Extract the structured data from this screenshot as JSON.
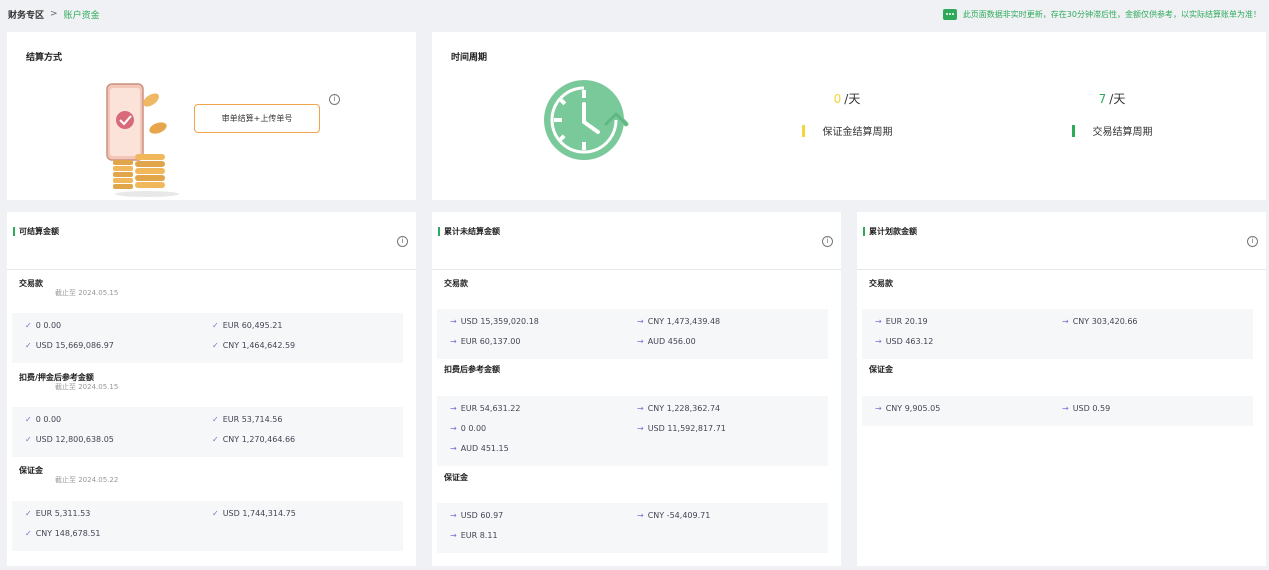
{
  "breadcrumb": {
    "level1": "财务专区",
    "separator": ">",
    "level2": "账户资金"
  },
  "notice": {
    "text": "此页面数据非实时更新，存在30分钟滞后性，金额仅供参考，以实际结算账单为准！"
  },
  "colors": {
    "accent": "#2eaa5a",
    "orange": "#f0a54a",
    "yellow": "#f5d53a",
    "clock": "#7ac99a",
    "item_icon": "#7a6fd0"
  },
  "settlement": {
    "title": "结算方式",
    "button": "审单结算+上传单号",
    "info": "i"
  },
  "period": {
    "title": "时间周期",
    "deposit": {
      "value": "0",
      "unit": "/天",
      "label": "保证金结算周期"
    },
    "trade": {
      "value": "7",
      "unit": "/天",
      "label": "交易结算周期"
    }
  },
  "available": {
    "title": "可结算金额",
    "info": "i",
    "sections": [
      {
        "title": "交易款",
        "date": "截止至 2024.05.15",
        "icon": "check-icon",
        "items": [
          "0 0.00",
          "EUR 60,495.21",
          "USD 15,669,086.97",
          "CNY 1,464,642.59"
        ]
      },
      {
        "title": "扣费/押金后参考金额",
        "date": "截止至 2024.05.15",
        "icon": "check-icon",
        "items": [
          "0 0.00",
          "EUR 53,714.56",
          "USD 12,800,638.05",
          "CNY 1,270,464.66"
        ]
      },
      {
        "title": "保证金",
        "date": "截止至 2024.05.22",
        "icon": "check-icon",
        "items": [
          "EUR 5,311.53",
          "USD 1,744,314.75",
          "CNY 148,678.51"
        ]
      }
    ]
  },
  "unsettled": {
    "title": "累计未结算金额",
    "info": "i",
    "sections": [
      {
        "title": "交易款",
        "icon": "arrow-icon",
        "items": [
          "USD 15,359,020.18",
          "CNY 1,473,439.48",
          "EUR 60,137.00",
          "AUD 456.00"
        ]
      },
      {
        "title": "扣费后参考金额",
        "icon": "arrow-icon",
        "items": [
          "EUR 54,631.22",
          "CNY 1,228,362.74",
          "0 0.00",
          "USD 11,592,817.71",
          "AUD 451.15"
        ]
      },
      {
        "title": "保证金",
        "icon": "arrow-icon",
        "items": [
          "USD 60.97",
          "CNY -54,409.71",
          "EUR 8.11"
        ]
      }
    ]
  },
  "transferred": {
    "title": "累计划款金额",
    "info": "i",
    "sections": [
      {
        "title": "交易款",
        "icon": "arrow-icon",
        "items": [
          "EUR 20.19",
          "CNY 303,420.66",
          "USD 463.12"
        ]
      },
      {
        "title": "保证金",
        "icon": "arrow-icon",
        "items": [
          "CNY 9,905.05",
          "USD 0.59"
        ]
      }
    ]
  }
}
